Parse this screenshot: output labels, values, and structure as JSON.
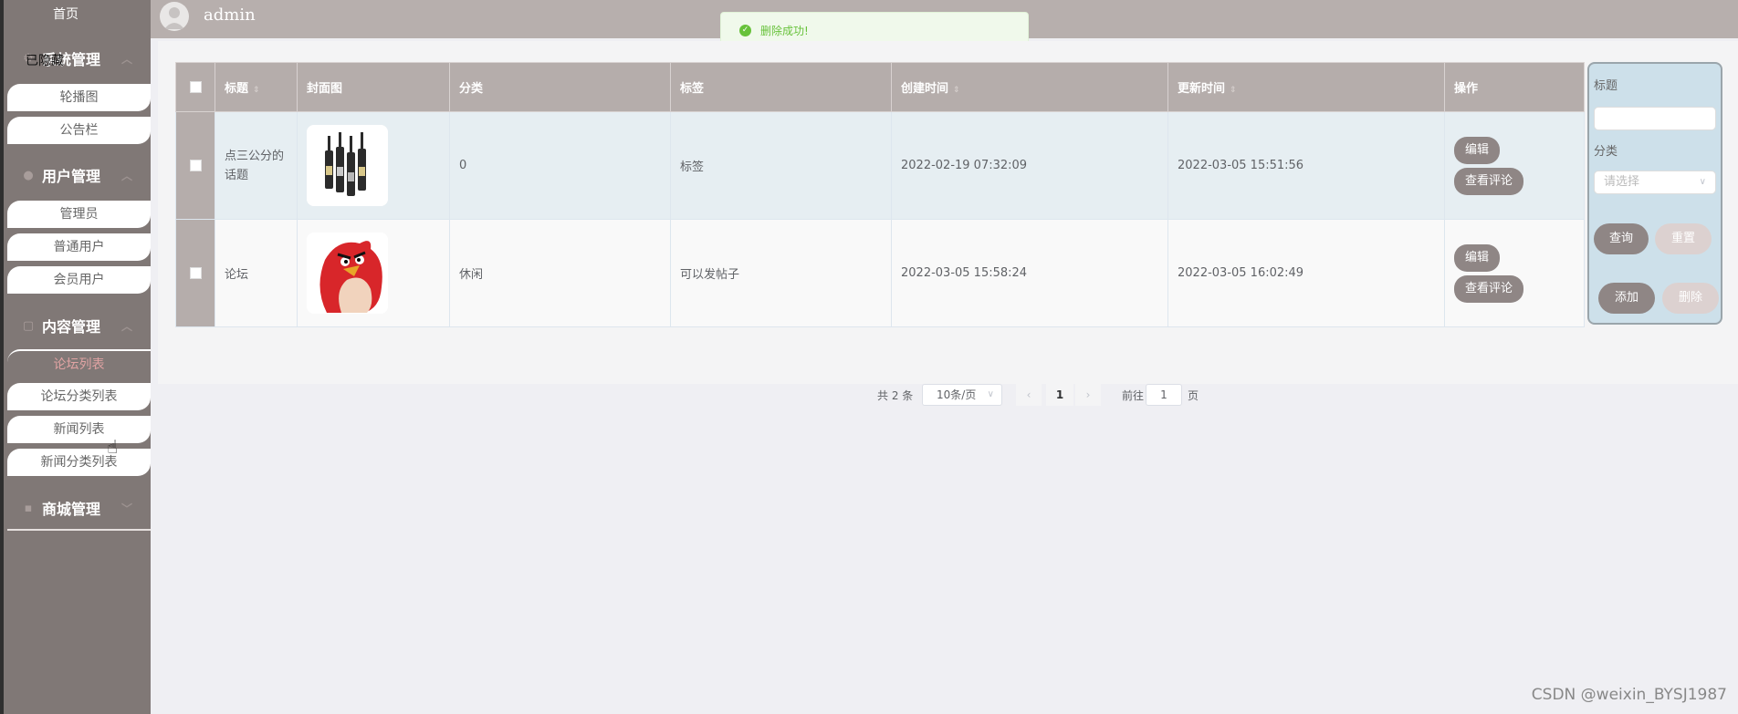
{
  "sidebar": {
    "home": "首页",
    "overlap_text": "已隐藏",
    "groups": [
      {
        "label": "系统管理",
        "items": [
          "轮播图",
          "公告栏"
        ]
      },
      {
        "label": "用户管理",
        "items": [
          "管理员",
          "普通用户",
          "会员用户"
        ]
      },
      {
        "label": "内容管理",
        "items": [
          "论坛列表",
          "论坛分类列表",
          "新闻列表",
          "新闻分类列表"
        ]
      },
      {
        "label": "商城管理",
        "items": []
      }
    ],
    "active_item": "论坛列表"
  },
  "header": {
    "username": "admin"
  },
  "toast": {
    "message": "删除成功!"
  },
  "table": {
    "columns": [
      "标题",
      "封面图",
      "分类",
      "标签",
      "创建时间",
      "更新时间",
      "操作"
    ],
    "rows": [
      {
        "title": "点三公分的话题",
        "category": "0",
        "tag": "标签",
        "created": "2022-02-19 07:32:09",
        "updated": "2022-03-05 15:51:56"
      },
      {
        "title": "论坛",
        "category": "休闲",
        "tag": "可以发帖子",
        "created": "2022-03-05 15:58:24",
        "updated": "2022-03-05 16:02:49"
      }
    ],
    "actions": {
      "edit": "编辑",
      "comments": "查看评论"
    }
  },
  "pagination": {
    "total": "共 2 条",
    "page_size": "10条/页",
    "current": "1",
    "jump_label": "前往",
    "jump_value": "1",
    "page_suffix": "页"
  },
  "search": {
    "title_label": "标题",
    "category_label": "分类",
    "category_placeholder": "请选择",
    "query": "查询",
    "reset": "重置",
    "add": "添加",
    "delete": "删除"
  },
  "watermark": "CSDN @weixin_BYSJ1987"
}
